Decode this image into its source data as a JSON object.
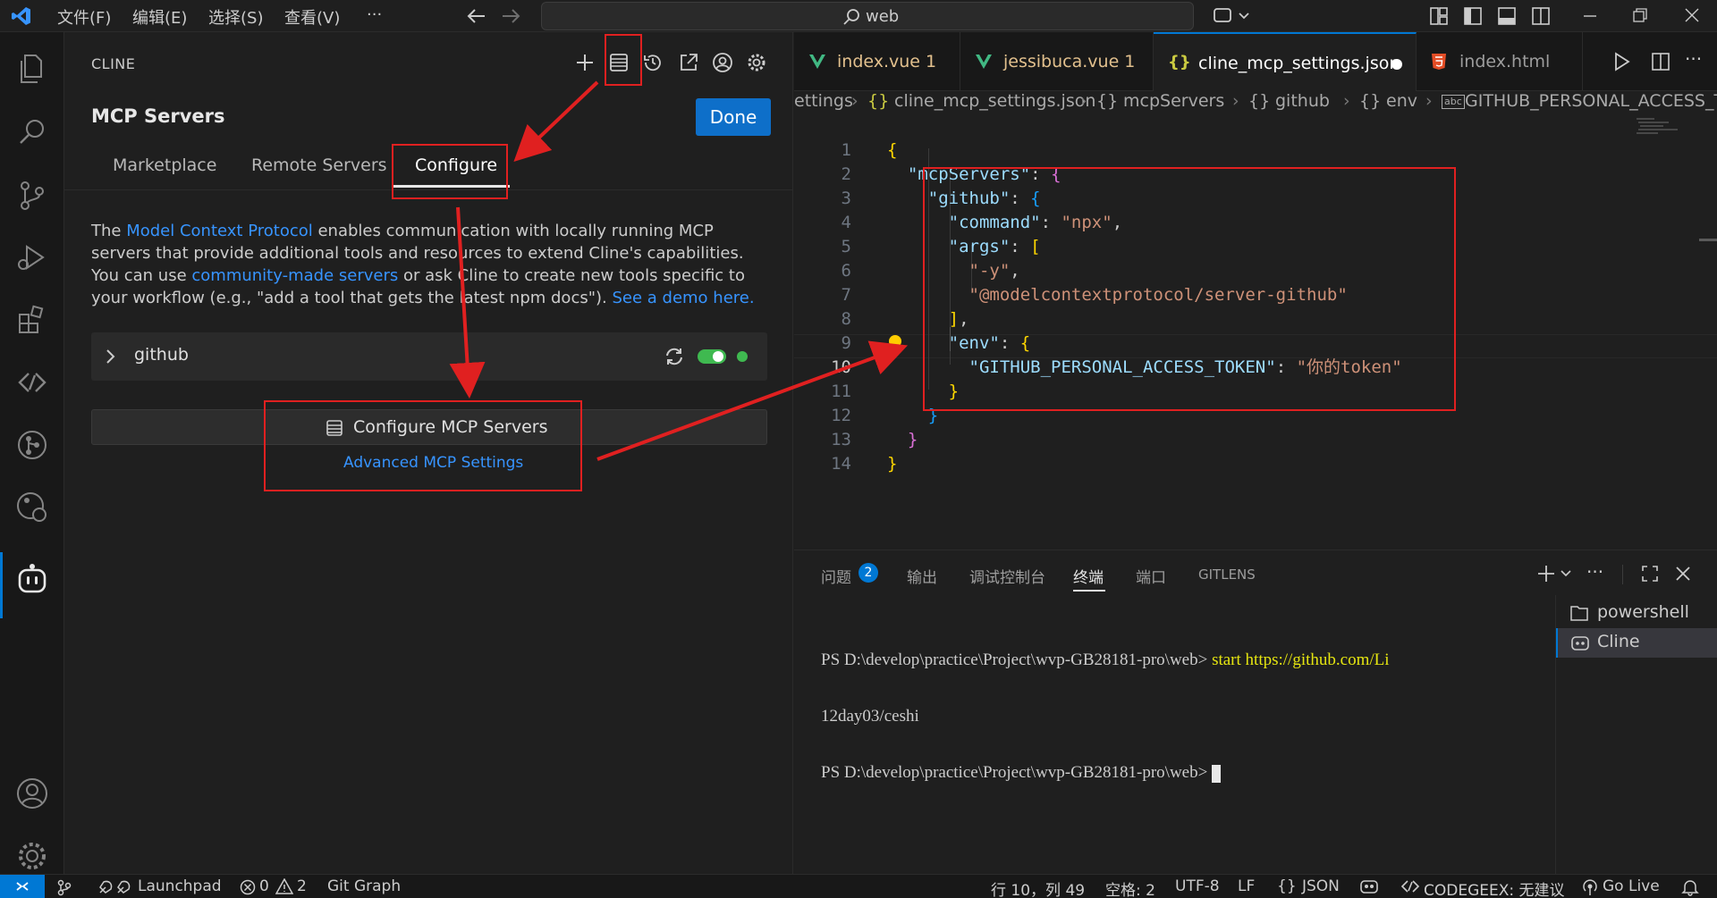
{
  "titlebar": {
    "menus": [
      "文件(F)",
      "编辑(E)",
      "选择(S)",
      "查看(V)",
      "···"
    ],
    "search": "web"
  },
  "cline": {
    "panel_title": "CLINE",
    "heading": "MCP Servers",
    "done_label": "Done",
    "tabs": [
      "Marketplace",
      "Remote Servers",
      "Configure"
    ],
    "active_tab": "Configure",
    "description": {
      "p1": "The ",
      "link1": "Model Context Protocol",
      "p2": " enables communication with locally running MCP servers that provide additional tools and resources to extend Cline's capabilities. You can use ",
      "link2": "community-made servers",
      "p3": " or ask Cline to create new tools specific to your workflow (e.g., \"add a tool that gets the latest npm docs\"). ",
      "link3": "See a demo here."
    },
    "server": {
      "name": "github",
      "enabled": true,
      "status_color": "#3fb950"
    },
    "configure_button": "Configure MCP Servers",
    "advanced_link": "Advanced MCP Settings"
  },
  "editor": {
    "tabs": [
      {
        "label": "index.vue 1",
        "icon": "vue-icon",
        "active": false
      },
      {
        "label": "jessibuca.vue 1",
        "icon": "vue-icon",
        "active": false
      },
      {
        "label": "cline_mcp_settings.json",
        "icon": "json-icon",
        "active": true,
        "modified": true
      },
      {
        "label": "index.html",
        "icon": "html-icon",
        "active": false
      }
    ],
    "breadcrumb": [
      "ettings",
      "cline_mcp_settings.json",
      "mcpServers",
      "github",
      "env",
      "GITHUB_PERSONAL_ACCESS_TOKEN"
    ],
    "line_numbers": [
      "1",
      "2",
      "3",
      "4",
      "5",
      "6",
      "7",
      "8",
      "9",
      "10",
      "11",
      "12",
      "13",
      "14"
    ],
    "current_line": "10",
    "code": {
      "mcpServers_key": "\"mcpServers\"",
      "github_key": "\"github\"",
      "command_key": "\"command\"",
      "command_val": "\"npx\"",
      "args_key": "\"args\"",
      "arg1": "\"-y\"",
      "arg2": "\"@modelcontextprotocol/server-github\"",
      "env_key": "\"env\"",
      "token_key": "\"GITHUB_PERSONAL_ACCESS_TOKEN\"",
      "token_val": "\"你的token\""
    }
  },
  "panel": {
    "tabs": [
      "问题",
      "输出",
      "调试控制台",
      "终端",
      "端口",
      "GITLENS"
    ],
    "problems_count": "2",
    "active_tab": "终端",
    "terminal_lines": [
      "PS D:\\develop\\practice\\Project\\wvp-GB28181-pro\\web> ",
      "start https://github.com/Li",
      "12day03/ceshi",
      "PS D:\\develop\\practice\\Project\\wvp-GB28181-pro\\web> "
    ],
    "terminals": [
      "powershell",
      "Cline"
    ],
    "active_terminal": "Cline"
  },
  "statusbar": {
    "launchpad": "Launchpad",
    "errors": "0",
    "warnings": "2",
    "git_graph": "Git Graph",
    "position": "行 10，列 49",
    "spaces": "空格: 2",
    "encoding": "UTF-8",
    "eol": "LF",
    "language": "JSON",
    "codegeex": "CODEGEEX: 无建议",
    "go_live": "Go Live"
  },
  "colors": {
    "accent": "#0078d4",
    "annotation": "#e02020",
    "link": "#3794ff",
    "toggle_on": "#3fb950"
  }
}
